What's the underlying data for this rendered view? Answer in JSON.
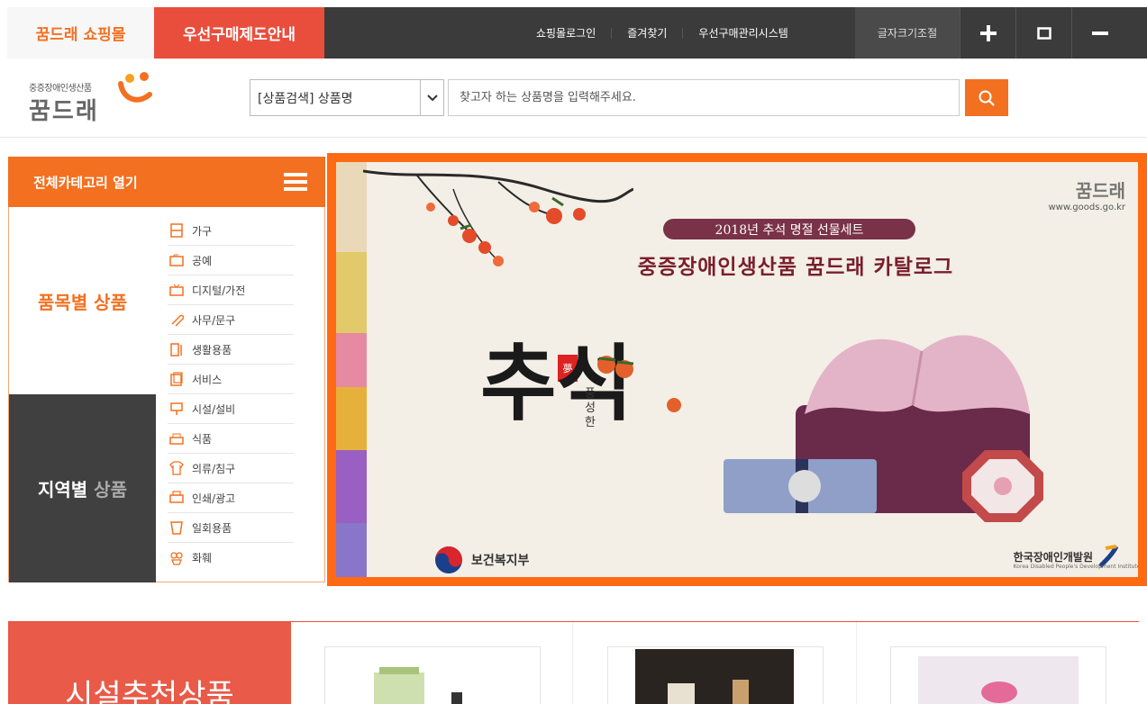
{
  "topbar": {
    "tab_shop": "꿈드래 쇼핑몰",
    "tab_info": "우선구매제도안내",
    "links": [
      "쇼핑몰로그인",
      "즐겨찾기",
      "우선구매관리시스템"
    ],
    "font_control_label": "글자크기조절",
    "font_plus": "+",
    "font_reset": "□",
    "font_minus": "−"
  },
  "logo": {
    "small_text": "중증장애인생산품",
    "brand": "꿈드래"
  },
  "search": {
    "category_selected": "[상품검색] 상품명",
    "placeholder": "찾고자 하는 상품명을 입력해주세요.",
    "icon": "search-icon"
  },
  "category_panel": {
    "header": "전체카테고리 열기",
    "by_item_label": "품목별 상품",
    "by_region_label_a": "지역별",
    "by_region_label_b": "상품",
    "items": [
      "가구",
      "공예",
      "디지털/가전",
      "사무/문구",
      "생활용품",
      "서비스",
      "시설/설비",
      "식품",
      "의류/침구",
      "인쇄/광고",
      "일회용품",
      "화훼"
    ]
  },
  "banner": {
    "badge": "2018년 추석 명절 선물세트",
    "title": "중증장애인생산품 꿈드래 카탈로그",
    "logo_name": "꿈드래",
    "logo_url": "www.goods.go.kr",
    "calligraphy": "추석",
    "vertical_text": "풍성한",
    "seal": "夢",
    "ministry": "보건복지부",
    "kepad": "한국장애인개발원",
    "kepad_sub": "Korea Disabled People's Development Institute"
  },
  "recommend": {
    "title": "시설추천상품"
  },
  "colors": {
    "brand_orange": "#f37021",
    "red": "#e94e3c",
    "dark": "#3b3b3b"
  }
}
